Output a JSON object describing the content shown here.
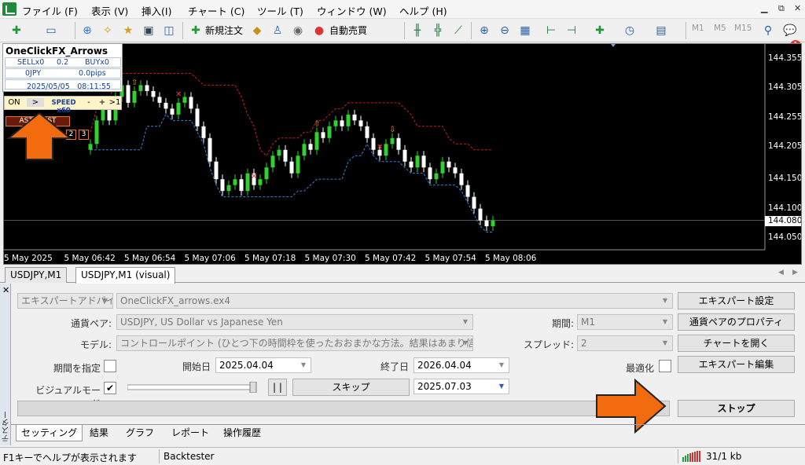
{
  "menu": {
    "items": [
      "ファイル (F)",
      "表示 (V)",
      "挿入(I)",
      "チャート (C)",
      "ツール (T)",
      "ウィンドウ (W)",
      "ヘルプ (H)"
    ]
  },
  "toolbar": {
    "new_order": "新規注文",
    "auto_trading": "自動売買",
    "timeframes": [
      "M1",
      "M5",
      "M15"
    ],
    "notification_count": "1"
  },
  "chart": {
    "price_ticks": [
      "144.355",
      "144.305",
      "144.255",
      "144.205",
      "144.150",
      "144.100",
      "144.050"
    ],
    "current_price": "144.080",
    "time_ticks": [
      "5 May 2025",
      "5 May 06:42",
      "5 May 06:54",
      "5 May 07:06",
      "5 May 07:18",
      "5 May 07:30",
      "5 May 07:42",
      "5 May 07:54",
      "5 May 08:06"
    ],
    "bull_color": "#2fd02f",
    "bear_color": "#ffffff",
    "upper_band_color": "#c81e1e",
    "lower_band_color": "#3a7fd8"
  },
  "chart_data": {
    "type": "candlestick",
    "symbol": "USDJPY,M1",
    "ylim": [
      144.03,
      144.38
    ],
    "close_series": [
      144.21,
      144.25,
      144.27,
      144.25,
      144.29,
      144.31,
      144.28,
      144.3,
      144.31,
      144.3,
      144.29,
      144.28,
      144.27,
      144.26,
      144.28,
      144.29,
      144.27,
      144.24,
      144.22,
      144.18,
      144.15,
      144.13,
      144.14,
      144.15,
      144.13,
      144.16,
      144.14,
      144.15,
      144.17,
      144.19,
      144.2,
      144.18,
      144.16,
      144.19,
      144.21,
      144.2,
      144.23,
      144.22,
      144.24,
      144.25,
      144.24,
      144.26,
      144.25,
      144.24,
      144.22,
      144.2,
      144.19,
      144.21,
      144.22,
      144.2,
      144.18,
      144.17,
      144.19,
      144.17,
      144.15,
      144.16,
      144.18,
      144.17,
      144.16,
      144.14,
      144.12,
      144.1,
      144.08,
      144.07,
      144.08
    ]
  },
  "ocfx": {
    "title": "OneClickFX_Arrows",
    "sell": "SELLx0",
    "lots": "0.2",
    "buy": "BUYx0",
    "pl_currency": "0JPY",
    "pl_pips": "0.0pips",
    "datetime": "2025/05/05　08:11:55",
    "controls": [
      "ON",
      ">",
      "SPEED x60",
      "-",
      "+",
      ">1"
    ],
    "hist_button": "ASTR HIST",
    "small_buttons": [
      "2",
      "3"
    ]
  },
  "tabs": {
    "chart_tabs": [
      "USDJPY,M1",
      "USDJPY,M1 (visual)"
    ]
  },
  "tester": {
    "side_label": "テスター",
    "mode_select": "エキスパートアドバイザ",
    "expert_file": "OneClickFX_arrows.ex4",
    "symbol_label": "通貨ペア:",
    "symbol_value": "USDJPY, US Dollar vs Japanese Yen",
    "model_label": "モデル:",
    "model_value": "コントロールポイント (ひとつ下の時間枠を使ったおおまかな方法。結果はあまり信頼性はない)",
    "period_label": "期間:",
    "period_value": "M1",
    "spread_label": "スプレッド:",
    "spread_value": "2",
    "use_date_label": "期間を指定",
    "start_label": "開始日",
    "start_value": "2025.04.04",
    "end_label": "終了日",
    "end_value": "2026.04.04",
    "optimize_label": "最適化",
    "visual_label": "ビジュアルモード",
    "visual_checked": "✔",
    "pause_label": "| |",
    "skip_label": "スキップ",
    "skip_date": "2025.07.03",
    "btn_expert_settings": "エキスパート設定",
    "btn_symbol_props": "通貨ペアのプロパティ",
    "btn_open_chart": "チャートを開く",
    "btn_edit_expert": "エキスパート編集",
    "btn_stop": "ストップ",
    "bottom_tabs": [
      "セッティング",
      "結果",
      "グラフ",
      "レポート",
      "操作履歴"
    ]
  },
  "status": {
    "help": "F1キーでヘルプが表示されます",
    "profile": "Backtester",
    "traffic": "31/1 kb"
  },
  "annotation": {
    "arrow_color": "#f26b0f"
  }
}
